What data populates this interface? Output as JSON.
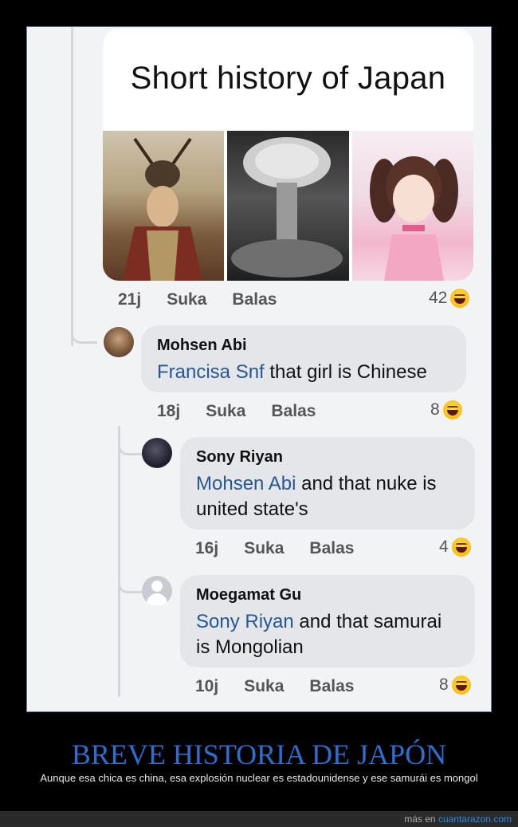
{
  "post": {
    "title": "Short history of Japan",
    "time": "21j",
    "like": "Suka",
    "reply": "Balas",
    "reactions": "42"
  },
  "comments": [
    {
      "name": "Mohsen Abi",
      "mention": "Francisa Snf",
      "text": " that girl is Chinese",
      "time": "18j",
      "like": "Suka",
      "reply": "Balas",
      "reactions": "8"
    },
    {
      "name": "Sony Riyan",
      "mention": "Mohsen Abi",
      "text": " and that nuke is united state's",
      "time": "16j",
      "like": "Suka",
      "reply": "Balas",
      "reactions": "4"
    },
    {
      "name": "Moegamat Gu",
      "mention": "Sony Riyan",
      "text": " and that samurai is Mongolian",
      "time": "10j",
      "like": "Suka",
      "reply": "Balas",
      "reactions": "8"
    }
  ],
  "caption": {
    "title": "BREVE HISTORIA DE JAPÓN",
    "subtitle": "Aunque esa chica es china, esa explosión nuclear es estadounidense y ese samurái es mongol"
  },
  "footer": {
    "prefix": "más en",
    "site": "cuantarazon.com"
  }
}
